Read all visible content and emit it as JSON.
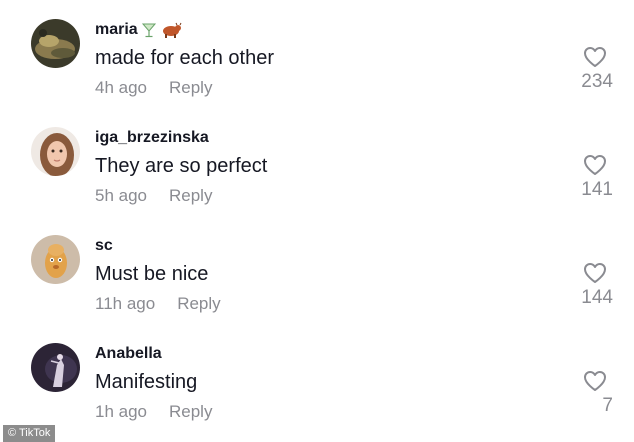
{
  "comments": [
    {
      "username": "maria",
      "text": "made for each other",
      "time": "4h ago",
      "reply": "Reply",
      "likes": "234"
    },
    {
      "username": "iga_brzezinska",
      "text": "They are so perfect",
      "time": "5h ago",
      "reply": "Reply",
      "likes": "141"
    },
    {
      "username": "sc",
      "text": "Must be nice",
      "time": "11h ago",
      "reply": "Reply",
      "likes": "144"
    },
    {
      "username": "Anabella",
      "text": "Manifesting",
      "time": "1h ago",
      "reply": "Reply",
      "likes": "7"
    }
  ],
  "username_emojis": [
    "cocktail-glass-emoji",
    "ox-emoji"
  ],
  "watermark": "© TikTok",
  "colors": {
    "text_primary": "#161823",
    "text_secondary": "#8a8b91",
    "background": "#ffffff"
  },
  "icons": {
    "like": "heart-outline-icon"
  }
}
